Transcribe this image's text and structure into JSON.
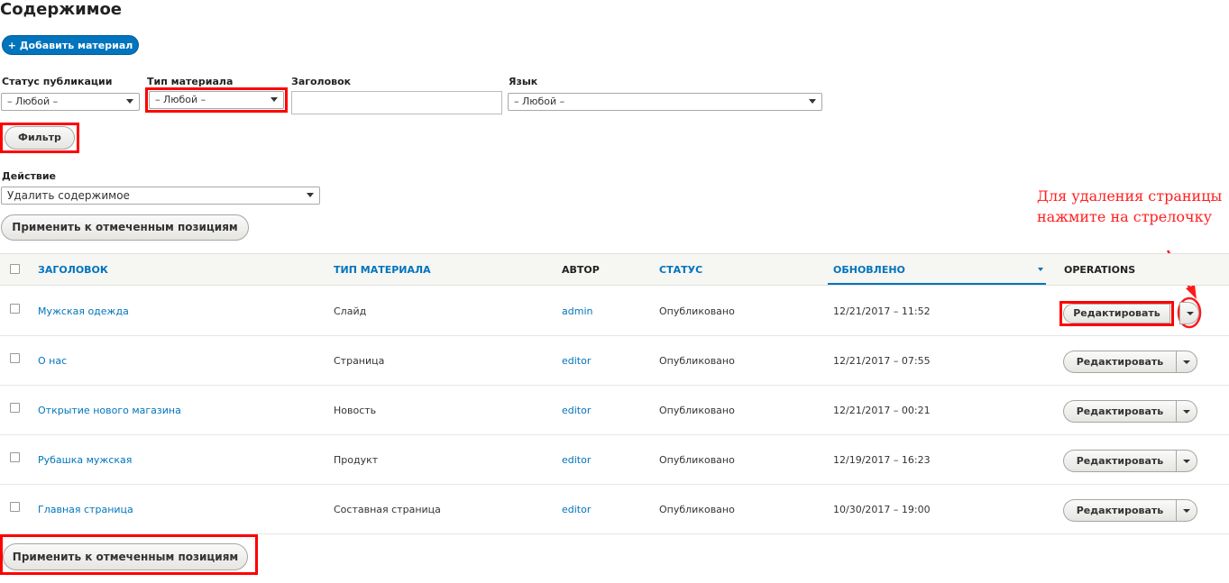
{
  "page": {
    "title": "Содержимое"
  },
  "toolbar": {
    "add_label": "+ Добавить материал"
  },
  "filters": {
    "status": {
      "label": "Статус публикации",
      "value": "– Любой –"
    },
    "type": {
      "label": "Тип материала",
      "value": "– Любой –"
    },
    "title": {
      "label": "Заголовок",
      "value": ""
    },
    "lang": {
      "label": "Язык",
      "value": "– Любой –"
    },
    "submit_label": "Фильтр"
  },
  "action": {
    "label": "Действие",
    "value": "Удалить содержимое",
    "apply_label": "Применить к отмеченным позициям"
  },
  "annotation": {
    "line1": "Для удаления страницы",
    "line2": "нажмите на стрелочку"
  },
  "table": {
    "headers": {
      "title": "ЗАГОЛОВОК",
      "type": "ТИП МАТЕРИАЛА",
      "author": "АВТОР",
      "status": "СТАТУС",
      "updated": "ОБНОВЛЕНО",
      "operations": "OPERATIONS"
    },
    "rows": [
      {
        "title": "Мужская одежда",
        "type": "Слайд",
        "author": "admin",
        "status": "Опубликовано",
        "updated": "12/21/2017 – 11:52",
        "edit": "Редактировать"
      },
      {
        "title": "О нас",
        "type": "Страница",
        "author": "editor",
        "status": "Опубликовано",
        "updated": "12/21/2017 – 07:55",
        "edit": "Редактировать"
      },
      {
        "title": "Открытие нового магазина",
        "type": "Новость",
        "author": "editor",
        "status": "Опубликовано",
        "updated": "12/21/2017 – 00:21",
        "edit": "Редактировать"
      },
      {
        "title": "Рубашка мужская",
        "type": "Продукт",
        "author": "editor",
        "status": "Опубликовано",
        "updated": "12/19/2017 – 16:23",
        "edit": "Редактировать"
      },
      {
        "title": "Главная страница",
        "type": "Составная страница",
        "author": "editor",
        "status": "Опубликовано",
        "updated": "10/30/2017 – 19:00",
        "edit": "Редактировать"
      }
    ]
  },
  "bottom": {
    "apply_label": "Применить к отмеченным позициям"
  },
  "colors": {
    "link": "#0074bd",
    "highlight": "#ff0000",
    "primary": "#0074bd"
  }
}
